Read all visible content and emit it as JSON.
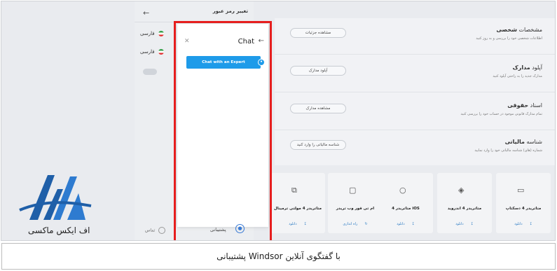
{
  "settings_panel": {
    "title": "تغییر رمز عبور",
    "languages": [
      "فارسی",
      "فارسی"
    ]
  },
  "cards": [
    {
      "title_light": "مشخصات",
      "title_bold": "شخصی",
      "subtitle": "اطلاعات شخصی خود را بررسی و به روز کنید",
      "button": "مشاهده جزئیات"
    },
    {
      "title_light": "آپلود",
      "title_bold": "مدارک",
      "subtitle": "مدارک جدید را به راحتی آپلود کنید",
      "button": "آپلود مدارک"
    },
    {
      "title_light": "اسناد",
      "title_bold": "حقوقی",
      "subtitle": "تمام مدارک قانونی موجود در حساب خود را بررسی کنید",
      "button": "مشاهده مدارک"
    },
    {
      "title_light": "شناسه",
      "title_bold": "مالیاتی",
      "subtitle": "شماره (های) شناسه مالیاتی خود را وارد نمایید",
      "button": "شناسه مالیاتی را وارد کنید"
    }
  ],
  "platforms": [
    {
      "title": "متاتریدر 4 دسکتاپ",
      "icon": "desktop-icon",
      "actions": [
        "دانلود"
      ]
    },
    {
      "title": "متاتریدر 4 اندروید",
      "icon": "android-icon",
      "actions": [
        "دانلود"
      ]
    },
    {
      "title": "متاتریدر 4 iOS",
      "icon": "apple-icon",
      "actions": [
        "دانلود"
      ]
    },
    {
      "title": "ام تی فور وب تریدر",
      "icon": "web-trader-icon",
      "actions": [
        "راه اندازی"
      ]
    },
    {
      "title": "متاتریدر 4 مولتی ترمینال",
      "icon": "multi-terminal-icon",
      "actions": [
        "دانلود"
      ]
    }
  ],
  "bottom": {
    "contact": "تماس",
    "support": "پشتیبانی"
  },
  "chat": {
    "title": "Chat",
    "expert_button": "Chat with an Expert"
  },
  "logo": {
    "text": "اف ایکس ماکسی"
  },
  "caption": "پشتیبانی Windsor با گفتگوی آنلاین",
  "colors": {
    "highlight": "#e61e1e",
    "chat_button": "#1e9be9",
    "link": "#2d7cc4"
  }
}
